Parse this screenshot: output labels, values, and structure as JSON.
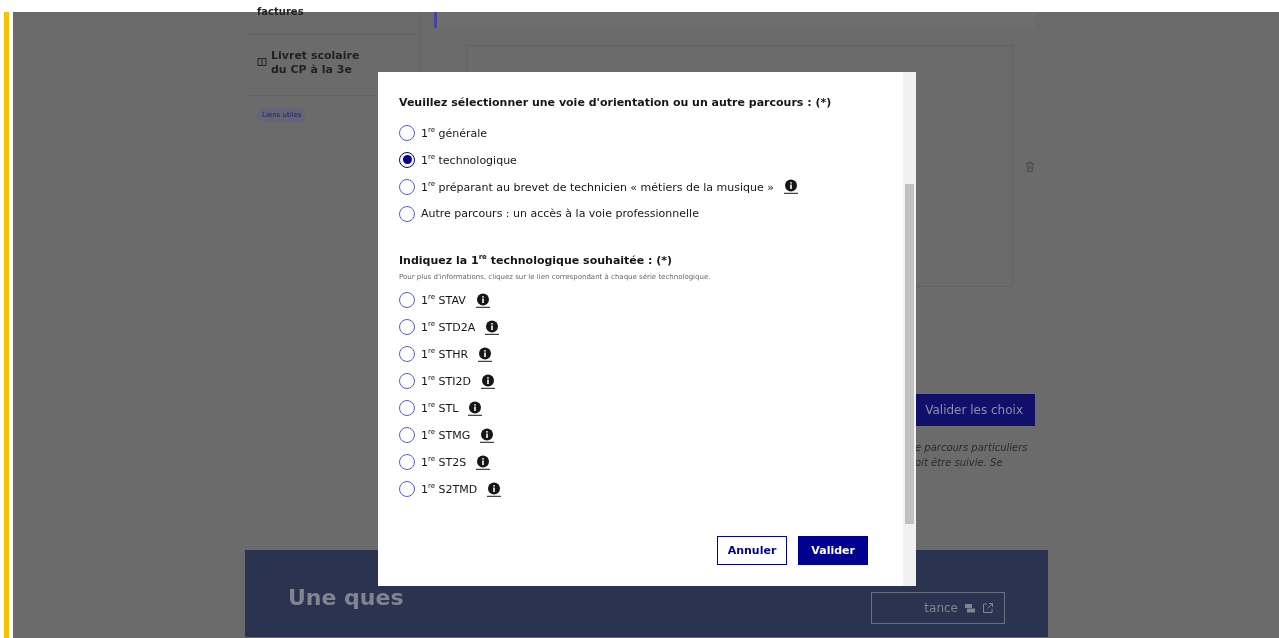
{
  "sidebar": {
    "items": [
      {
        "label": "factures",
        "kind": "plain"
      },
      {
        "label": "Livret scolaire du CP à la 3e",
        "kind": "book"
      }
    ],
    "chip": "Liens utiles"
  },
  "main": {
    "submit_button": "Valider les choix",
    "note_lines": [
      "e parcours particuliers",
      "oit être suivie. Se"
    ]
  },
  "help_banner": {
    "title": "Une ques",
    "button": "tance"
  },
  "modal": {
    "question": "Veuillez sélectionner une voie d'orientation ou un autre parcours : (*)",
    "paths": [
      {
        "label": "1$^{re}$ générale",
        "selected": false,
        "info": false
      },
      {
        "label": "1$^{re}$ technologique",
        "selected": true,
        "info": false
      },
      {
        "label": "1$^{re}$ préparant au brevet de technicien « métiers de la musique »",
        "selected": false,
        "info": true
      },
      {
        "label": "Autre parcours : un accès à la voie professionnelle",
        "selected": false,
        "info": false
      }
    ],
    "series_question": "Indiquez la 1$^{re}$ technologique souhaitée : (*)",
    "series_hint": "Pour plus d'informations, cliquez sur le lien correspondant à chaque série technologique.",
    "series": [
      {
        "label": "1$^{re}$ STAV",
        "selected": false,
        "info": true
      },
      {
        "label": "1$^{re}$ STD2A",
        "selected": false,
        "info": true
      },
      {
        "label": "1$^{re}$ STHR",
        "selected": false,
        "info": true
      },
      {
        "label": "1$^{re}$ STI2D",
        "selected": false,
        "info": true
      },
      {
        "label": "1$^{re}$ STL",
        "selected": false,
        "info": true
      },
      {
        "label": "1$^{re}$ STMG",
        "selected": false,
        "info": true
      },
      {
        "label": "1$^{re}$ ST2S",
        "selected": false,
        "info": true
      },
      {
        "label": "1$^{re}$ S2TMD",
        "selected": false,
        "info": true
      }
    ],
    "cancel_button": "Annuler",
    "confirm_button": "Valider"
  }
}
